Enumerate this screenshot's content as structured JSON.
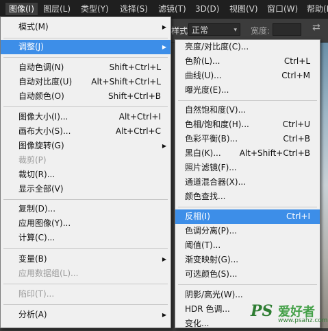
{
  "menubar": {
    "items": [
      "图像(I)",
      "图层(L)",
      "类型(Y)",
      "选择(S)",
      "滤镜(T)",
      "3D(D)",
      "视图(V)",
      "窗口(W)",
      "帮助(H)"
    ]
  },
  "options_bar": {
    "mode_label": "样式:",
    "mode_value": "正常",
    "width_label": "宽度:",
    "swap_icon": "⇄"
  },
  "image_menu": {
    "items": [
      {
        "label": "模式(M)",
        "shortcut": "",
        "submenu": true
      },
      {
        "label": "调整(J)",
        "shortcut": "",
        "submenu": true,
        "highlighted": true
      },
      {
        "label": "自动色调(N)",
        "shortcut": "Shift+Ctrl+L"
      },
      {
        "label": "自动对比度(U)",
        "shortcut": "Alt+Shift+Ctrl+L"
      },
      {
        "label": "自动颜色(O)",
        "shortcut": "Shift+Ctrl+B"
      },
      {
        "label": "图像大小(I)...",
        "shortcut": "Alt+Ctrl+I"
      },
      {
        "label": "画布大小(S)...",
        "shortcut": "Alt+Ctrl+C"
      },
      {
        "label": "图像旋转(G)",
        "shortcut": "",
        "submenu": true
      },
      {
        "label": "裁剪(P)",
        "shortcut": "",
        "disabled": true
      },
      {
        "label": "裁切(R)...",
        "shortcut": ""
      },
      {
        "label": "显示全部(V)",
        "shortcut": ""
      },
      {
        "label": "复制(D)...",
        "shortcut": ""
      },
      {
        "label": "应用图像(Y)...",
        "shortcut": ""
      },
      {
        "label": "计算(C)...",
        "shortcut": ""
      },
      {
        "label": "变量(B)",
        "shortcut": "",
        "submenu": true
      },
      {
        "label": "应用数据组(L)...",
        "shortcut": "",
        "disabled": true
      },
      {
        "label": "陷印(T)...",
        "shortcut": "",
        "disabled": true
      },
      {
        "label": "分析(A)",
        "shortcut": "",
        "submenu": true
      }
    ]
  },
  "adjust_menu": {
    "items": [
      {
        "label": "亮度/对比度(C)...",
        "shortcut": ""
      },
      {
        "label": "色阶(L)...",
        "shortcut": "Ctrl+L"
      },
      {
        "label": "曲线(U)...",
        "shortcut": "Ctrl+M"
      },
      {
        "label": "曝光度(E)...",
        "shortcut": ""
      },
      {
        "label": "自然饱和度(V)...",
        "shortcut": ""
      },
      {
        "label": "色相/饱和度(H)...",
        "shortcut": "Ctrl+U"
      },
      {
        "label": "色彩平衡(B)...",
        "shortcut": "Ctrl+B"
      },
      {
        "label": "黑白(K)...",
        "shortcut": "Alt+Shift+Ctrl+B"
      },
      {
        "label": "照片滤镜(F)...",
        "shortcut": ""
      },
      {
        "label": "通道混合器(X)...",
        "shortcut": ""
      },
      {
        "label": "颜色查找...",
        "shortcut": ""
      },
      {
        "label": "反相(I)",
        "shortcut": "Ctrl+I",
        "highlighted": true
      },
      {
        "label": "色调分离(P)...",
        "shortcut": ""
      },
      {
        "label": "阈值(T)...",
        "shortcut": ""
      },
      {
        "label": "渐变映射(G)...",
        "shortcut": ""
      },
      {
        "label": "可选颜色(S)...",
        "shortcut": ""
      },
      {
        "label": "阴影/高光(W)...",
        "shortcut": ""
      },
      {
        "label": "HDR 色调...",
        "shortcut": ""
      },
      {
        "label": "变化...",
        "shortcut": ""
      }
    ]
  },
  "watermark": {
    "logo": "PS",
    "name": "爱好者",
    "url": "www.psahz.com"
  }
}
